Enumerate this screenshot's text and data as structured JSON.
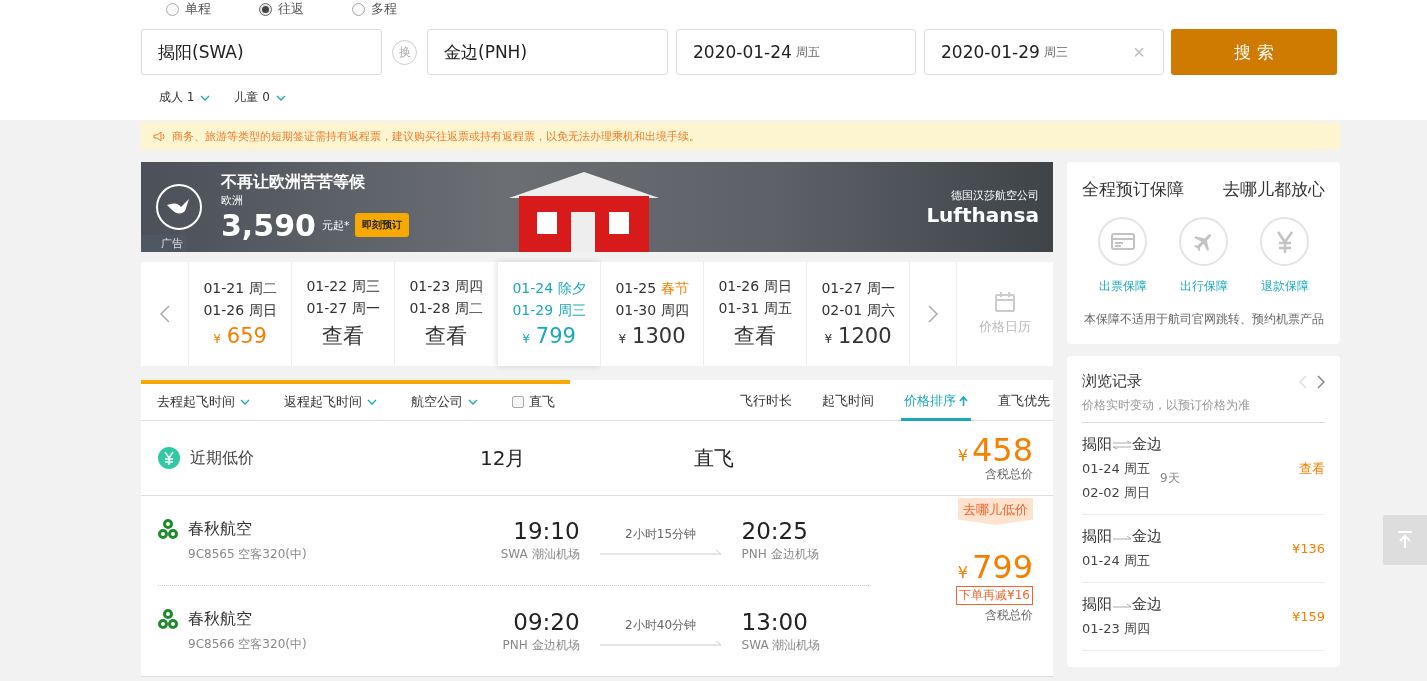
{
  "trip_types": [
    {
      "label": "单程",
      "selected": false
    },
    {
      "label": "往返",
      "selected": true
    },
    {
      "label": "多程",
      "selected": false
    }
  ],
  "search": {
    "from": "揭阳(SWA)",
    "swap": "换",
    "to": "金边(PNH)",
    "depart": {
      "date": "2020-01-24",
      "day": "周五"
    },
    "return": {
      "date": "2020-01-29",
      "day": "周三"
    },
    "clear": "×",
    "button": "搜 索"
  },
  "passengers": [
    {
      "label": "成人",
      "count": "1"
    },
    {
      "label": "儿童",
      "count": "0"
    }
  ],
  "notice": "商务、旅游等类型的短期签证需持有返程票，建议购买往返票或持有返程票，以免无法办理乘机和出境手续。",
  "ad": {
    "headline": "不再让欧洲苦苦等候",
    "region": "欧洲",
    "price": "3,590",
    "unit": "元起*",
    "cta": "即刻预订",
    "airline_cn": "德国汉莎航空公司",
    "airline": "Lufthansa",
    "tag": "广告"
  },
  "date_strip": [
    {
      "out": "01-21",
      "out_day": "周二",
      "out_holiday": false,
      "back": "01-26 周日",
      "kind": "price",
      "currency": "¥",
      "price": "659",
      "lowest": true,
      "selected": false
    },
    {
      "out": "01-22",
      "out_day": "周三",
      "out_holiday": false,
      "back": "01-27 周一",
      "kind": "view",
      "label": "查看",
      "selected": false
    },
    {
      "out": "01-23",
      "out_day": "周四",
      "out_holiday": false,
      "back": "01-28 周二",
      "kind": "view",
      "label": "查看",
      "selected": false
    },
    {
      "out": "01-24",
      "out_day": "除夕",
      "back": "01-29 周三",
      "kind": "price",
      "currency": "¥",
      "price": "799",
      "selected": true
    },
    {
      "out": "01-25",
      "out_day": "春节",
      "out_holiday": true,
      "back": "01-30 周四",
      "kind": "price",
      "currency": "¥",
      "price": "1300",
      "lowest": false,
      "selected": false
    },
    {
      "out": "01-26",
      "out_day": "周日",
      "out_holiday": false,
      "back": "01-31 周五",
      "kind": "view",
      "label": "查看",
      "selected": false
    },
    {
      "out": "01-27",
      "out_day": "周一",
      "out_holiday": false,
      "back": "02-01 周六",
      "kind": "price",
      "currency": "¥",
      "price": "1200",
      "lowest": false,
      "selected": false
    }
  ],
  "calendar_label": "价格日历",
  "loading": {
    "level": 0.47
  },
  "filters": [
    {
      "kind": "dropdown",
      "label": "去程起飞时间"
    },
    {
      "kind": "dropdown",
      "label": "返程起飞时间"
    },
    {
      "kind": "dropdown",
      "label": "航空公司"
    },
    {
      "kind": "checkbox",
      "label": "直飞",
      "checked": false
    }
  ],
  "sorts": [
    {
      "label": "飞行时长",
      "selected": false,
      "arrow": false
    },
    {
      "label": "起飞时间",
      "selected": false,
      "arrow": false
    },
    {
      "label": "价格排序",
      "selected": true,
      "arrow": true
    },
    {
      "label": "直飞优先",
      "selected": false,
      "arrow": false
    }
  ],
  "low_price": {
    "label": "近期低价",
    "month": "12月",
    "type": "直飞",
    "currency": "¥",
    "price": "458",
    "note": "含税总价"
  },
  "result": {
    "tag": "去哪儿低价",
    "legs": [
      {
        "airline": "春秋航空",
        "flight": "9C8565 空客320(中)",
        "dep_time": "19:10",
        "dep_airport": "SWA 潮汕机场",
        "duration": "2小时15分钟",
        "arr_time": "20:25",
        "arr_airport": "PNH 金边机场"
      },
      {
        "airline": "春秋航空",
        "flight": "9C8566 空客320(中)",
        "dep_time": "09:20",
        "dep_airport": "PNH 金边机场",
        "duration": "2小时40分钟",
        "arr_time": "13:00",
        "arr_airport": "SWA 潮汕机场"
      }
    ],
    "currency": "¥",
    "price": "799",
    "discount": "下单再减¥16",
    "note": "含税总价"
  },
  "guarantee": {
    "title": "全程预订保障",
    "slogan": "去哪儿都放心",
    "items": [
      {
        "kind": "ticket",
        "label": "出票保障"
      },
      {
        "kind": "plane",
        "label": "出行保障"
      },
      {
        "kind": "yuan",
        "label": "退款保障"
      }
    ],
    "note": "本保障不适用于航司官网跳转、预约机票产品"
  },
  "history": {
    "title": "浏览记录",
    "subtitle": "价格实时变动，以预订价格为准",
    "items": [
      {
        "from": "揭阳",
        "to": "金边",
        "kind": "round",
        "dates": [
          "01-24 周五",
          "02-02 周日"
        ],
        "days": "9天",
        "action": "查看"
      },
      {
        "from": "揭阳",
        "to": "金边",
        "kind": "oneway",
        "dates": [
          "01-24 周五"
        ],
        "action": "¥136"
      },
      {
        "from": "揭阳",
        "to": "金边",
        "kind": "oneway",
        "dates": [
          "01-23 周四"
        ],
        "action": "¥159"
      }
    ]
  }
}
